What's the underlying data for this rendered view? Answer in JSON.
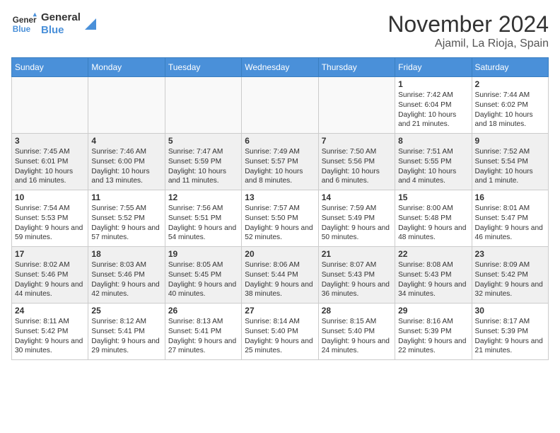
{
  "header": {
    "logo_general": "General",
    "logo_blue": "Blue",
    "month": "November 2024",
    "location": "Ajamil, La Rioja, Spain"
  },
  "weekdays": [
    "Sunday",
    "Monday",
    "Tuesday",
    "Wednesday",
    "Thursday",
    "Friday",
    "Saturday"
  ],
  "weeks": [
    [
      {
        "day": "",
        "info": ""
      },
      {
        "day": "",
        "info": ""
      },
      {
        "day": "",
        "info": ""
      },
      {
        "day": "",
        "info": ""
      },
      {
        "day": "",
        "info": ""
      },
      {
        "day": "1",
        "info": "Sunrise: 7:42 AM\nSunset: 6:04 PM\nDaylight: 10 hours and 21 minutes."
      },
      {
        "day": "2",
        "info": "Sunrise: 7:44 AM\nSunset: 6:02 PM\nDaylight: 10 hours and 18 minutes."
      }
    ],
    [
      {
        "day": "3",
        "info": "Sunrise: 7:45 AM\nSunset: 6:01 PM\nDaylight: 10 hours and 16 minutes."
      },
      {
        "day": "4",
        "info": "Sunrise: 7:46 AM\nSunset: 6:00 PM\nDaylight: 10 hours and 13 minutes."
      },
      {
        "day": "5",
        "info": "Sunrise: 7:47 AM\nSunset: 5:59 PM\nDaylight: 10 hours and 11 minutes."
      },
      {
        "day": "6",
        "info": "Sunrise: 7:49 AM\nSunset: 5:57 PM\nDaylight: 10 hours and 8 minutes."
      },
      {
        "day": "7",
        "info": "Sunrise: 7:50 AM\nSunset: 5:56 PM\nDaylight: 10 hours and 6 minutes."
      },
      {
        "day": "8",
        "info": "Sunrise: 7:51 AM\nSunset: 5:55 PM\nDaylight: 10 hours and 4 minutes."
      },
      {
        "day": "9",
        "info": "Sunrise: 7:52 AM\nSunset: 5:54 PM\nDaylight: 10 hours and 1 minute."
      }
    ],
    [
      {
        "day": "10",
        "info": "Sunrise: 7:54 AM\nSunset: 5:53 PM\nDaylight: 9 hours and 59 minutes."
      },
      {
        "day": "11",
        "info": "Sunrise: 7:55 AM\nSunset: 5:52 PM\nDaylight: 9 hours and 57 minutes."
      },
      {
        "day": "12",
        "info": "Sunrise: 7:56 AM\nSunset: 5:51 PM\nDaylight: 9 hours and 54 minutes."
      },
      {
        "day": "13",
        "info": "Sunrise: 7:57 AM\nSunset: 5:50 PM\nDaylight: 9 hours and 52 minutes."
      },
      {
        "day": "14",
        "info": "Sunrise: 7:59 AM\nSunset: 5:49 PM\nDaylight: 9 hours and 50 minutes."
      },
      {
        "day": "15",
        "info": "Sunrise: 8:00 AM\nSunset: 5:48 PM\nDaylight: 9 hours and 48 minutes."
      },
      {
        "day": "16",
        "info": "Sunrise: 8:01 AM\nSunset: 5:47 PM\nDaylight: 9 hours and 46 minutes."
      }
    ],
    [
      {
        "day": "17",
        "info": "Sunrise: 8:02 AM\nSunset: 5:46 PM\nDaylight: 9 hours and 44 minutes."
      },
      {
        "day": "18",
        "info": "Sunrise: 8:03 AM\nSunset: 5:46 PM\nDaylight: 9 hours and 42 minutes."
      },
      {
        "day": "19",
        "info": "Sunrise: 8:05 AM\nSunset: 5:45 PM\nDaylight: 9 hours and 40 minutes."
      },
      {
        "day": "20",
        "info": "Sunrise: 8:06 AM\nSunset: 5:44 PM\nDaylight: 9 hours and 38 minutes."
      },
      {
        "day": "21",
        "info": "Sunrise: 8:07 AM\nSunset: 5:43 PM\nDaylight: 9 hours and 36 minutes."
      },
      {
        "day": "22",
        "info": "Sunrise: 8:08 AM\nSunset: 5:43 PM\nDaylight: 9 hours and 34 minutes."
      },
      {
        "day": "23",
        "info": "Sunrise: 8:09 AM\nSunset: 5:42 PM\nDaylight: 9 hours and 32 minutes."
      }
    ],
    [
      {
        "day": "24",
        "info": "Sunrise: 8:11 AM\nSunset: 5:42 PM\nDaylight: 9 hours and 30 minutes."
      },
      {
        "day": "25",
        "info": "Sunrise: 8:12 AM\nSunset: 5:41 PM\nDaylight: 9 hours and 29 minutes."
      },
      {
        "day": "26",
        "info": "Sunrise: 8:13 AM\nSunset: 5:41 PM\nDaylight: 9 hours and 27 minutes."
      },
      {
        "day": "27",
        "info": "Sunrise: 8:14 AM\nSunset: 5:40 PM\nDaylight: 9 hours and 25 minutes."
      },
      {
        "day": "28",
        "info": "Sunrise: 8:15 AM\nSunset: 5:40 PM\nDaylight: 9 hours and 24 minutes."
      },
      {
        "day": "29",
        "info": "Sunrise: 8:16 AM\nSunset: 5:39 PM\nDaylight: 9 hours and 22 minutes."
      },
      {
        "day": "30",
        "info": "Sunrise: 8:17 AM\nSunset: 5:39 PM\nDaylight: 9 hours and 21 minutes."
      }
    ]
  ]
}
